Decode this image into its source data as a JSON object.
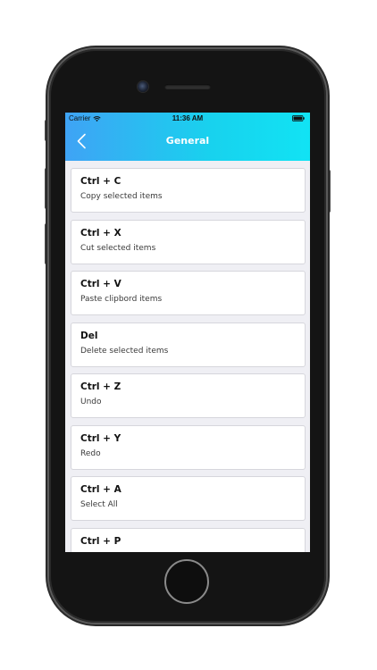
{
  "status_bar": {
    "carrier": "Carrier",
    "time": "11:36 AM",
    "wifi_icon": "wifi-icon",
    "battery_icon": "battery-icon"
  },
  "nav": {
    "title": "General",
    "back_icon": "chevron-left-icon",
    "gradient_start": "#3fa3f5",
    "gradient_end": "#11e3f4"
  },
  "shortcuts": [
    {
      "keys": "Ctrl + C",
      "description": "Copy selected items"
    },
    {
      "keys": "Ctrl + X",
      "description": "Cut selected items"
    },
    {
      "keys": "Ctrl + V",
      "description": "Paste clipbord items"
    },
    {
      "keys": "Del",
      "description": "Delete selected items"
    },
    {
      "keys": "Ctrl + Z",
      "description": "Undo"
    },
    {
      "keys": "Ctrl + Y",
      "description": "Redo"
    },
    {
      "keys": "Ctrl + A",
      "description": "Select All"
    },
    {
      "keys": "Ctrl + P",
      "description": ""
    }
  ]
}
